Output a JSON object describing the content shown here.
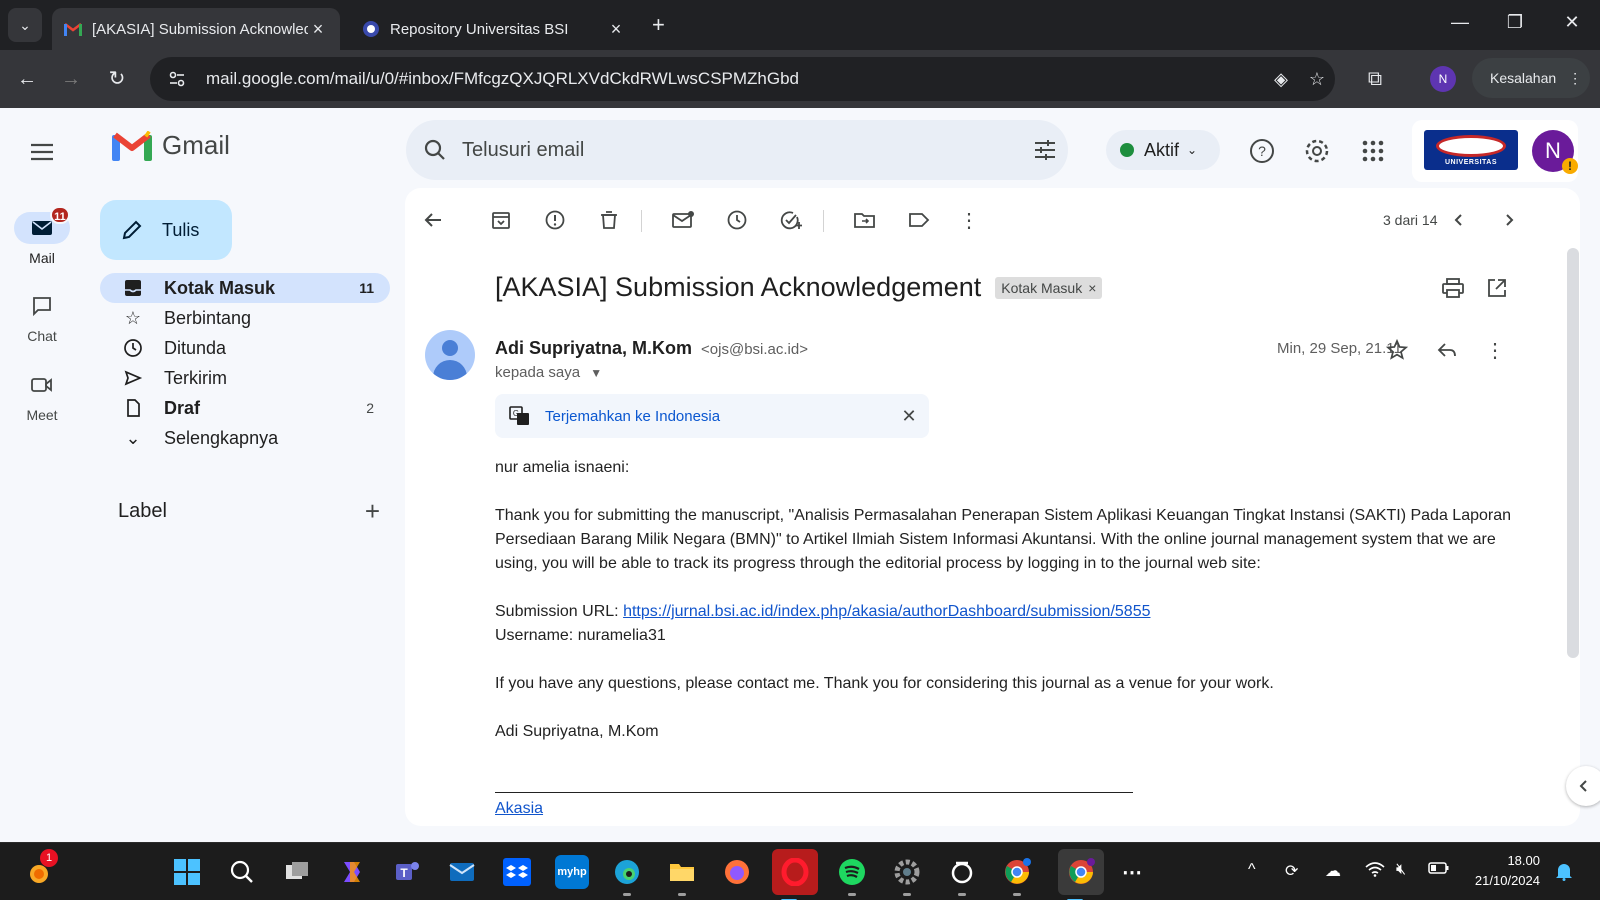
{
  "browser": {
    "tabs": [
      {
        "title": "[AKASIA] Submission Acknowledgement",
        "active": true
      },
      {
        "title": "Repository Universitas BSI",
        "active": false
      }
    ],
    "url": "mail.google.com/mail/u/0/#inbox/FMfcgzQXJQRLXVdCkdRWLwsCSPMZhGbd",
    "profile_initial": "N",
    "profile_label": "Kesalahan"
  },
  "gmail": {
    "brand": "Gmail",
    "rail": [
      {
        "label": "Mail",
        "badge": "11",
        "icon": "mail-icon"
      },
      {
        "label": "Chat",
        "icon": "chat-icon"
      },
      {
        "label": "Meet",
        "icon": "video-icon"
      }
    ],
    "compose_label": "Tulis",
    "nav": [
      {
        "label": "Kotak Masuk",
        "count": "11",
        "icon": "inbox-icon"
      },
      {
        "label": "Berbintang",
        "count": "",
        "icon": "star-icon"
      },
      {
        "label": "Ditunda",
        "count": "",
        "icon": "clock-icon"
      },
      {
        "label": "Terkirim",
        "count": "",
        "icon": "send-icon"
      },
      {
        "label": "Draf",
        "count": "2",
        "icon": "draft-icon"
      },
      {
        "label": "Selengkapnya",
        "count": "",
        "icon": "chevron-down-icon"
      }
    ],
    "labels_heading": "Label",
    "search_placeholder": "Telusuri email",
    "status": "Aktif",
    "avatar_initial": "N",
    "org_logo_text": "UNIVERSITAS",
    "pager": "3 dari 14"
  },
  "email": {
    "subject": "[AKASIA] Submission Acknowledgement",
    "chip": "Kotak Masuk",
    "sender_name": "Adi Supriyatna, M.Kom",
    "sender_email": "<ojs@bsi.ac.id>",
    "to": "kepada saya",
    "date": "Min, 29 Sep, 21.11",
    "translate_label": "Terjemahkan ke Indonesia",
    "greeting": "nur amelia isnaeni:",
    "paragraph1": "Thank you for submitting the manuscript, \"Analisis Permasalahan Penerapan Sistem Aplikasi Keuangan Tingkat Instansi (SAKTI) Pada Laporan Persediaan Barang Milik Negara (BMN)\" to Artikel Ilmiah Sistem Informasi Akuntansi. With the online journal management system that we are using, you will be able to track its progress through the editorial process by logging in to the journal web site:",
    "submission_url_label": "Submission URL:",
    "submission_url": "https://jurnal.bsi.ac.id/index.php/akasia/authorDashboard/submission/5855",
    "username_line": "Username: nuramelia31",
    "paragraph2": "If you have any questions, please contact me. Thank you for considering this journal as a venue for your work.",
    "signature": "Adi Supriyatna, M.Kom",
    "footer_link": "Akasia"
  },
  "taskbar": {
    "notification_badge": "1",
    "time": "18.00",
    "date": "21/10/2024"
  },
  "colors": {
    "accent": "#0b57d0",
    "compose": "#c2e7ff",
    "nav_active": "#d3e3fd",
    "badge": "#b3261e",
    "status_dot": "#1e8e3e"
  }
}
